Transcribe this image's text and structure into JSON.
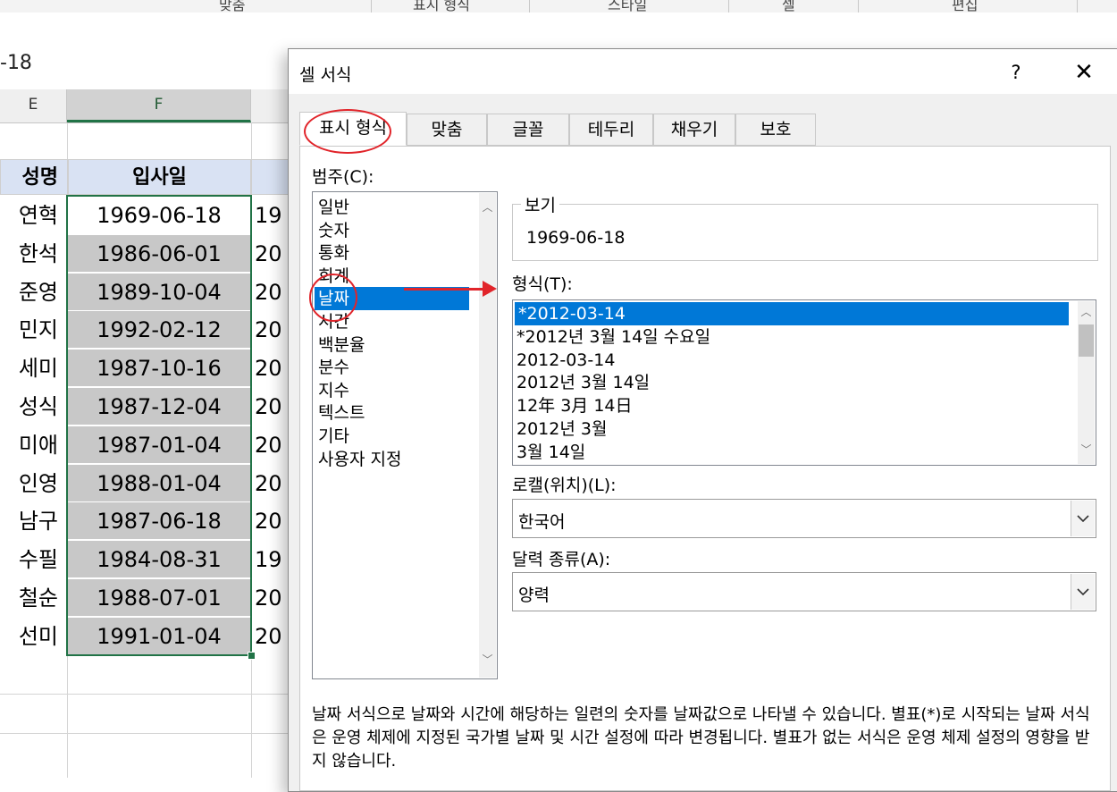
{
  "formula_bar": {
    "text": "-18"
  },
  "ribbon": {
    "labels": [
      "맞춤",
      "표시 형식",
      "스타일",
      "셀",
      "편집"
    ]
  },
  "spreadsheet": {
    "columns": [
      "E",
      "F"
    ],
    "headers": [
      "성명",
      "입사일"
    ],
    "names": [
      "연혁",
      "한석",
      "준영",
      "민지",
      "세미",
      "성식",
      "미애",
      "인영",
      "남구",
      "수필",
      "철순",
      "선미"
    ],
    "dates": [
      "1969-06-18",
      "1986-06-01",
      "1989-10-04",
      "1992-02-12",
      "1987-10-16",
      "1987-12-04",
      "1987-01-04",
      "1988-01-04",
      "1987-06-18",
      "1984-08-31",
      "1988-07-01",
      "1991-01-04"
    ],
    "col_g": [
      "19",
      "20",
      "20",
      "20",
      "20",
      "20",
      "20",
      "20",
      "20",
      "19",
      "20",
      "20"
    ]
  },
  "dialog": {
    "title": "셀 서식",
    "help_label": "?",
    "close_label": "✕",
    "tabs": [
      "표시 형식",
      "맞춤",
      "글꼴",
      "테두리",
      "채우기",
      "보호"
    ],
    "category_label": "범주(C):",
    "categories": [
      "일반",
      "숫자",
      "통화",
      "회계",
      "날짜",
      "시간",
      "백분율",
      "분수",
      "지수",
      "텍스트",
      "기타",
      "사용자 지정"
    ],
    "selected_category": "날짜",
    "sample_label": "보기",
    "sample_value": "1969-06-18",
    "type_label": "형식(T):",
    "types": [
      "*2012-03-14",
      "*2012년 3월 14일 수요일",
      "2012-03-14",
      "2012년 3월 14일",
      "12年 3月 14日",
      "2012년 3월",
      "3월 14일"
    ],
    "selected_type": "*2012-03-14",
    "locale_label": "로캘(위치)(L):",
    "locale_value": "한국어",
    "calendar_label": "달력 종류(A):",
    "calendar_value": "양력",
    "description": "날짜 서식으로 날짜와 시간에 해당하는 일련의 숫자를 날짜값으로 나타낼 수 있습니다. 별표(*)로 시작되는 날짜 서식은 운영 체제에 지정된 국가별 날짜 및 시간 설정에 따라 변경됩니다. 별표가 없는 서식은 운영 체제 설정의 영향을 받지 않습니다."
  },
  "colors": {
    "accent": "#0078d7",
    "selection_green": "#217346",
    "annotation_red": "#e1242a",
    "header_fill": "#d9e2f3"
  }
}
